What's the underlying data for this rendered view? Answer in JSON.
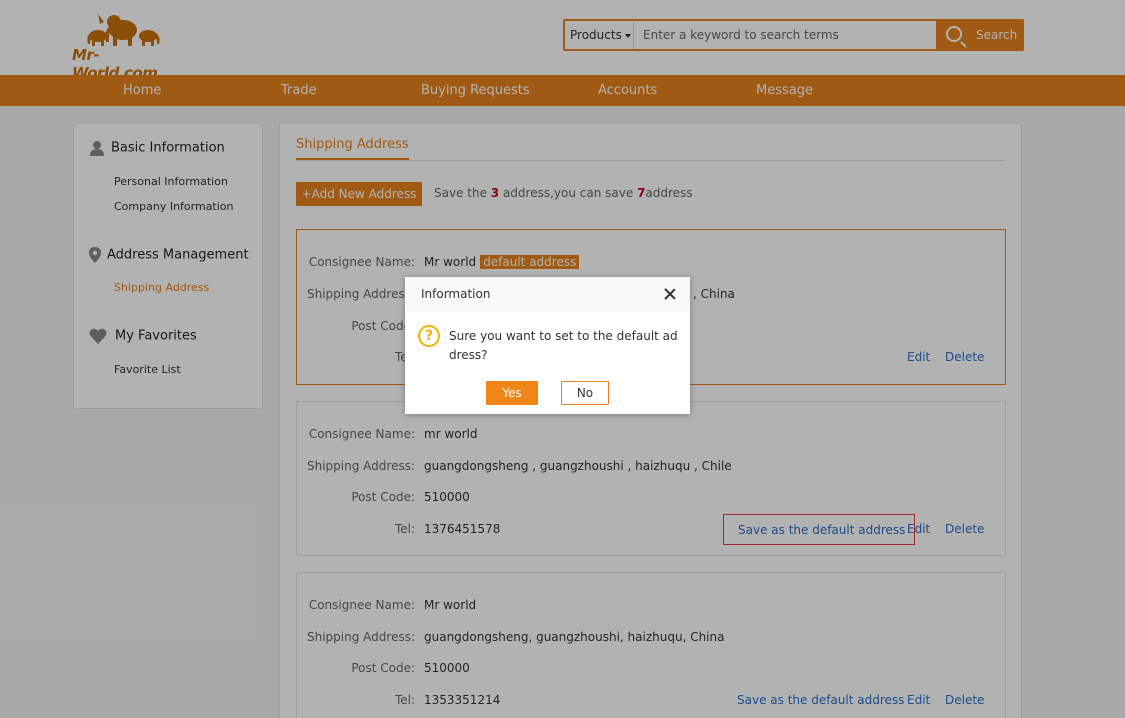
{
  "header": {
    "logo_text": "Mr-World.com",
    "search": {
      "category": "Products",
      "placeholder": "Enter a keyword to search terms",
      "button_label": "Search"
    }
  },
  "nav": {
    "items": [
      {
        "label": "Home"
      },
      {
        "label": "Trade"
      },
      {
        "label": "Buying Requests"
      },
      {
        "label": "Accounts"
      },
      {
        "label": "Message"
      }
    ]
  },
  "sidebar": {
    "sections": [
      {
        "title": "Basic Information",
        "icon": "user-icon",
        "links": [
          "Personal Information",
          "Company Information"
        ]
      },
      {
        "title": "Address Management",
        "icon": "location-pin-icon",
        "links": [
          "Shipping Address"
        ]
      },
      {
        "title": "My Favorites",
        "icon": "heart-icon",
        "links": [
          "Favorite List"
        ]
      }
    ],
    "active_link": "Shipping Address"
  },
  "main": {
    "tab_title": "Shipping Address",
    "add_button": "+Add New Address",
    "save_info": {
      "prefix": "Save the ",
      "saved_count": "3",
      "middle": " address,you can save ",
      "remaining_count": "7",
      "suffix": "address"
    },
    "labels": {
      "consignee": "Consignee Name:",
      "shipping": "Shipping Address:",
      "post_code": "Post Code:",
      "tel": "Tel:"
    },
    "default_tag": "default address",
    "actions": {
      "set_default": "Save as the default address",
      "edit": "Edit",
      "delete": "Delete"
    },
    "addresses": [
      {
        "consignee": "Mr world",
        "shipping_visible_tail": ", China",
        "is_default": true
      },
      {
        "consignee": "mr world",
        "shipping": "guangdongsheng , guangzhoushi , haizhuqu , Chile",
        "post_code": "510000",
        "tel": "1376451578"
      },
      {
        "consignee": "Mr world",
        "shipping": "guangdongsheng, guangzhoushi, haizhuqu, China",
        "post_code": "510000",
        "tel": "1353351214"
      }
    ]
  },
  "dialog": {
    "title": "Information",
    "message": "Sure you want to set to the default address?",
    "yes_label": "Yes",
    "no_label": "No"
  },
  "colors": {
    "brand_orange": "#e6811c",
    "link_blue": "#2a6fc7",
    "highlight_red": "#d0021b",
    "warning_yellow": "#f2b400"
  }
}
